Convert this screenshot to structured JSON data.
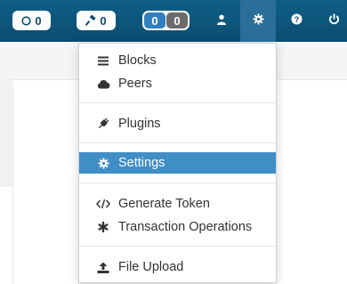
{
  "navbar": {
    "badges": [
      {
        "icon": "circle-outline-icon",
        "value": "0"
      },
      {
        "icon": "hammer-icon",
        "value": "0"
      }
    ],
    "toggle": {
      "left_value": "0",
      "right_value": "0"
    },
    "icons": [
      "user-icon",
      "gear-icon",
      "question-icon",
      "power-icon"
    ],
    "active_icon": "gear-icon"
  },
  "menu": {
    "items": [
      {
        "label": "Blocks",
        "icon": "list-icon"
      },
      {
        "label": "Peers",
        "icon": "cloud-icon"
      },
      {
        "label": "Plugins",
        "icon": "plug-icon"
      },
      {
        "label": "Settings",
        "icon": "gear-icon",
        "active": true
      },
      {
        "label": "Generate Token",
        "icon": "code-icon"
      },
      {
        "label": "Transaction Operations",
        "icon": "asterisk-icon"
      },
      {
        "label": "File Upload",
        "icon": "upload-icon"
      }
    ]
  },
  "colors": {
    "navbar": "#0b4d70",
    "active": "#3f8ec6",
    "text": "#333333"
  }
}
